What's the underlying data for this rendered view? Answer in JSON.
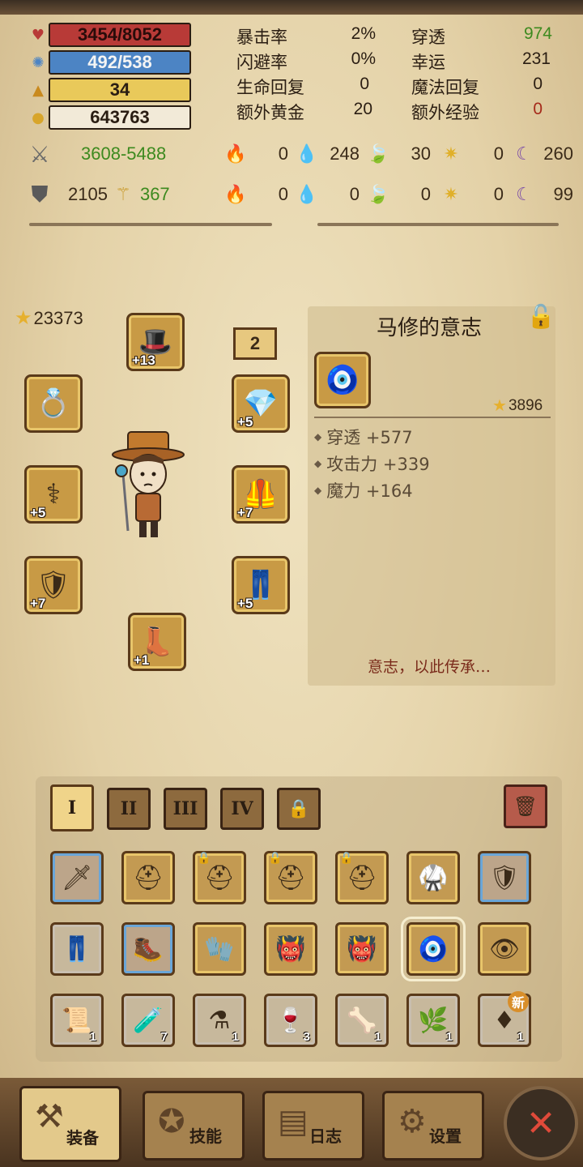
{
  "resources": {
    "hp": "3454/8052",
    "mp": "492/538",
    "level": "34",
    "gold": "643763"
  },
  "stats": [
    {
      "label": "暴击率",
      "value": "2%"
    },
    {
      "label": "闪避率",
      "value": "0%"
    },
    {
      "label": "生命回复",
      "value": "0"
    },
    {
      "label": "额外黄金",
      "value": "20"
    },
    {
      "label": "穿透",
      "value": "974"
    },
    {
      "label": "幸运",
      "value": "231"
    },
    {
      "label": "魔法回复",
      "value": "0"
    },
    {
      "label": "额外经验",
      "value": "0"
    }
  ],
  "attack": {
    "range": "3608-5488"
  },
  "defense": {
    "armor": "2105",
    "magic": "367"
  },
  "element_attack": [
    "0",
    "248",
    "30",
    "0",
    "260"
  ],
  "element_resist": [
    "0",
    "0",
    "0",
    "0",
    "99"
  ],
  "equipment": {
    "total_score": "23373",
    "badge": "2",
    "slots": [
      {
        "name": "hat",
        "plus": "+13"
      },
      {
        "name": "ring",
        "plus": ""
      },
      {
        "name": "staff",
        "plus": "+5"
      },
      {
        "name": "bracer",
        "plus": "+7"
      },
      {
        "name": "boots",
        "plus": "+1"
      },
      {
        "name": "amulet",
        "plus": "+5"
      },
      {
        "name": "chest",
        "plus": "+7"
      },
      {
        "name": "pants",
        "plus": "+5"
      }
    ]
  },
  "detail": {
    "title": "马修的意志",
    "score": "3896",
    "attrs": [
      "穿透 +577",
      "攻击力 +339",
      "魔力 +164"
    ],
    "quote": "意志，以此传承…"
  },
  "tabs": [
    "I",
    "II",
    "III",
    "IV"
  ],
  "inventory": [
    {
      "icon": "sword-icon",
      "count": ""
    },
    {
      "icon": "helmet-icon",
      "count": ""
    },
    {
      "icon": "locked-helmet-icon",
      "count": ""
    },
    {
      "icon": "locked-helmet-icon",
      "count": ""
    },
    {
      "icon": "locked-helmet-icon",
      "count": ""
    },
    {
      "icon": "dark-armor-icon",
      "count": ""
    },
    {
      "icon": "plate-armor-icon",
      "count": ""
    },
    {
      "icon": "leather-pants-icon",
      "count": ""
    },
    {
      "icon": "steel-boots-icon",
      "count": ""
    },
    {
      "icon": "gauntlet-icon",
      "count": ""
    },
    {
      "icon": "horned-helm-icon",
      "count": ""
    },
    {
      "icon": "horned-helm-icon",
      "count": ""
    },
    {
      "icon": "will-amulet-icon",
      "count": ""
    },
    {
      "icon": "eye-helm-icon",
      "count": ""
    },
    {
      "icon": "scroll-icon",
      "count": "1"
    },
    {
      "icon": "red-potion-icon",
      "count": "7"
    },
    {
      "icon": "blue-potion-icon",
      "count": "1"
    },
    {
      "icon": "purple-potion-icon",
      "count": "3"
    },
    {
      "icon": "bone-icon",
      "count": "1"
    },
    {
      "icon": "herb-icon",
      "count": "1"
    },
    {
      "icon": "red-gem-icon",
      "count": "1"
    }
  ],
  "new_tag": "新",
  "nav": [
    "装备",
    "技能",
    "日志",
    "设置"
  ],
  "colors": {
    "hp": "#b83a37",
    "mp": "#4c84c4",
    "level": "#e9c95a",
    "accent_green": "#3d8a1f",
    "accent_red": "#a52a1a"
  }
}
